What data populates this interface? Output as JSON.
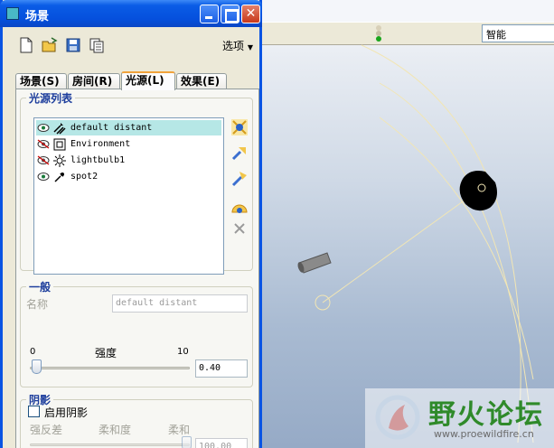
{
  "dialog": {
    "title": "场景",
    "options_menu": "选项",
    "tabs": [
      {
        "label": "场景(S)",
        "active": false
      },
      {
        "label": "房间(R)",
        "active": false
      },
      {
        "label": "光源(L)",
        "active": true
      },
      {
        "label": "效果(E)",
        "active": false
      }
    ],
    "light_list": {
      "group_title": "光源列表",
      "items": [
        {
          "name": "default distant",
          "selected": true,
          "visible": true,
          "icon": "distant-light-icon"
        },
        {
          "name": "Environment",
          "selected": false,
          "visible": false,
          "icon": "environment-light-icon"
        },
        {
          "name": "lightbulb1",
          "selected": false,
          "visible": false,
          "icon": "lightbulb-icon"
        },
        {
          "name": "spot2",
          "selected": false,
          "visible": true,
          "icon": "spot-light-icon"
        }
      ]
    },
    "general": {
      "group_title": "一般",
      "name_label": "名称",
      "name_value": "default distant",
      "intensity_label": "强度",
      "intensity_min": "0",
      "intensity_max": "10",
      "intensity_value": "0.40"
    },
    "shadow": {
      "group_title": "阴影",
      "enable_label": "启用阴影",
      "enabled": false,
      "labels": [
        "强反差",
        "柔和度",
        "柔和"
      ],
      "softness_value": "100.00"
    }
  },
  "toolbar": {
    "smart_select": "智能"
  },
  "watermark": {
    "title": "野火论坛",
    "url": "www.proewildfire.cn"
  },
  "colors": {
    "title_bar": "#0a5ce6",
    "group_title": "#1c3d9c",
    "selection": "#b6e7e6",
    "watermark_green": "#2f8a2a"
  }
}
